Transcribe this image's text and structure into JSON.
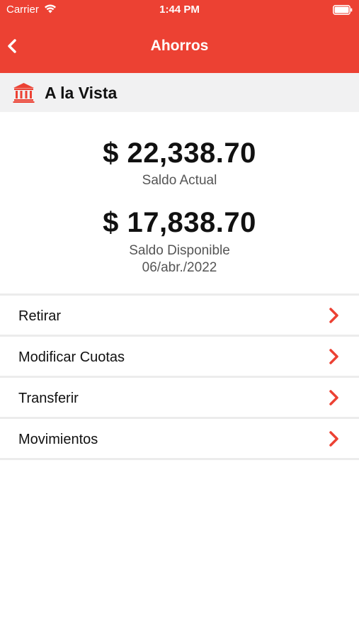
{
  "status_bar": {
    "carrier": "Carrier",
    "time": "1:44 PM"
  },
  "nav": {
    "title": "Ahorros",
    "back_icon": "chevron-left-icon"
  },
  "account": {
    "icon": "bank-icon",
    "name": "A la Vista"
  },
  "balances": {
    "current_amount": "$ 22,338.70",
    "current_label": "Saldo Actual",
    "available_amount": "$ 17,838.70",
    "available_label": "Saldo Disponible",
    "date": "06/abr./2022"
  },
  "menu": {
    "items": [
      {
        "label": "Retirar"
      },
      {
        "label": "Modificar Cuotas"
      },
      {
        "label": "Transferir"
      },
      {
        "label": "Movimientos"
      }
    ]
  },
  "colors": {
    "brand_red": "#ec4133",
    "header_gray": "#f1f1f2",
    "divider": "#ececec"
  }
}
